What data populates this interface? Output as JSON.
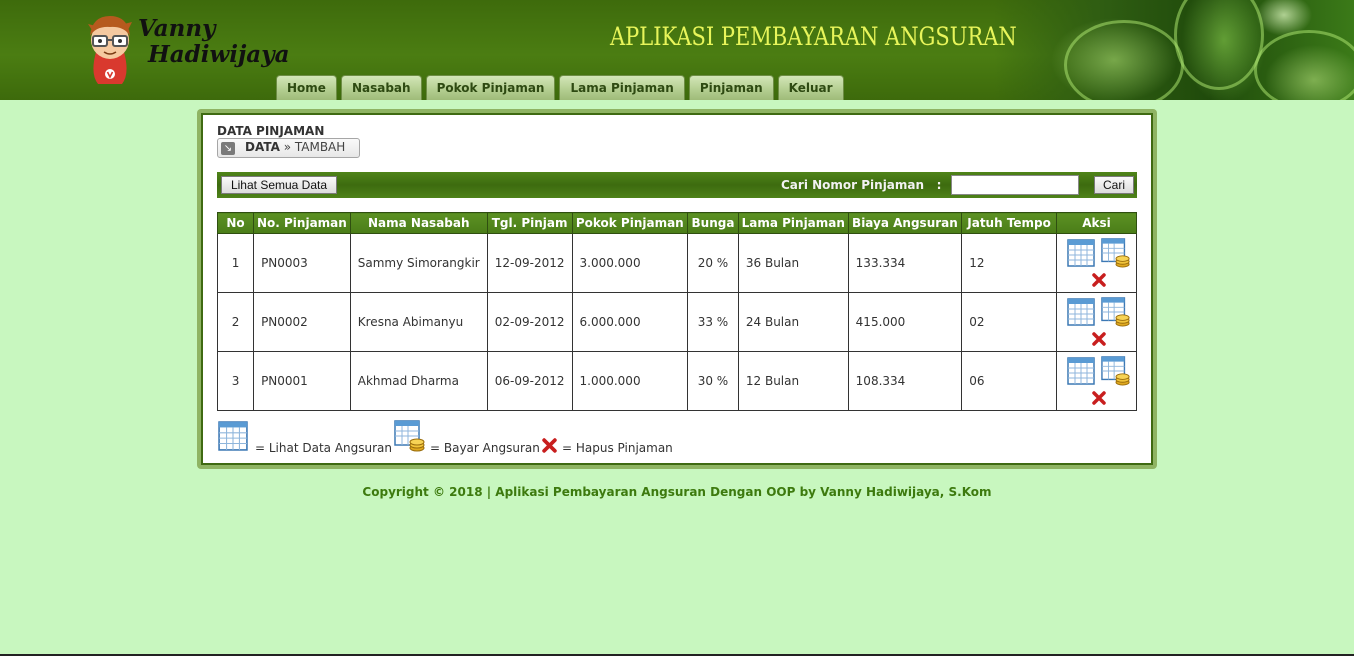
{
  "brand": {
    "logo_line1": "Vanny",
    "logo_line2": "Hadiwijaya",
    "app_title": "APLIKASI PEMBAYARAN ANGSURAN"
  },
  "nav": {
    "items": [
      "Home",
      "Nasabah",
      "Pokok Pinjaman",
      "Lama Pinjaman",
      "Pinjaman",
      "Keluar"
    ]
  },
  "page": {
    "title": "DATA PINJAMAN",
    "breadcrumb_current": "DATA",
    "breadcrumb_separator": "»",
    "breadcrumb_link": "TAMBAH"
  },
  "toolbar": {
    "view_all_label": "Lihat Semua Data",
    "search_label": "Cari Nomor Pinjaman   :",
    "search_value": "",
    "search_button": "Cari"
  },
  "table": {
    "headers": [
      "No",
      "No. Pinjaman",
      "Nama Nasabah",
      "Tgl. Pinjam",
      "Pokok Pinjaman",
      "Bunga",
      "Lama Pinjaman",
      "Biaya Angsuran",
      "Jatuh Tempo",
      "Aksi"
    ],
    "rows": [
      {
        "no": "1",
        "no_pinjaman": "PN0003",
        "nama": "Sammy Simorangkir",
        "tgl": "12-09-2012",
        "pokok": "3.000.000",
        "bunga": "20 %",
        "lama": "36 Bulan",
        "biaya": "133.334",
        "tempo": "12"
      },
      {
        "no": "2",
        "no_pinjaman": "PN0002",
        "nama": "Kresna Abimanyu",
        "tgl": "02-09-2012",
        "pokok": "6.000.000",
        "bunga": "33 %",
        "lama": "24 Bulan",
        "biaya": "415.000",
        "tempo": "02"
      },
      {
        "no": "3",
        "no_pinjaman": "PN0001",
        "nama": "Akhmad Dharma",
        "tgl": "06-09-2012",
        "pokok": "1.000.000",
        "bunga": "30 %",
        "lama": "12 Bulan",
        "biaya": "108.334",
        "tempo": "06"
      }
    ]
  },
  "legend": {
    "view": "= Lihat Data Angsuran",
    "pay": "= Bayar Angsuran",
    "delete": "= Hapus Pinjaman"
  },
  "footer": {
    "text": "Copyright © 2018 | Aplikasi Pembayaran Angsuran Dengan OOP by Vanny Hadiwijaya, S.Kom"
  },
  "colors": {
    "header_green": "#4b7d12",
    "page_bg": "#c8f7bf",
    "title_yellow": "#e8f55a",
    "footer_green": "#3d7a0e"
  },
  "icons": {
    "view": "table-icon",
    "pay": "table-coins-icon",
    "delete": "red-x-icon",
    "breadcrumb": "arrow-icon"
  }
}
